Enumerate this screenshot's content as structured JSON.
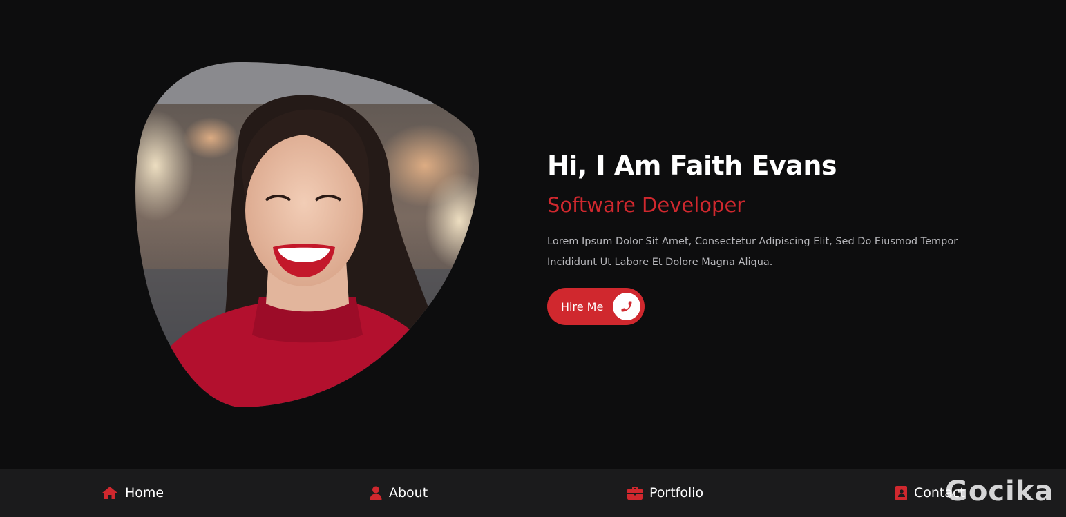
{
  "hero": {
    "title": "Hi, I Am Faith Evans",
    "role": "Software Developer",
    "description": "Lorem Ipsum Dolor Sit Amet, Consectetur Adipiscing Elit, Sed Do Eiusmod Tempor Incididunt Ut Labore Et Dolore Magna Aliqua.",
    "hire_button": {
      "label": "Hire Me",
      "icon": "phone-icon"
    },
    "photo_alt": "profile-photo"
  },
  "nav": {
    "items": [
      {
        "label": "Home",
        "icon": "home-icon"
      },
      {
        "label": "About",
        "icon": "user-icon"
      },
      {
        "label": "Portfolio",
        "icon": "briefcase-icon"
      },
      {
        "label": "Contact",
        "icon": "address-book-icon"
      }
    ]
  },
  "watermark": "Gocika",
  "colors": {
    "accent": "#d0282e",
    "background": "#0d0d0e",
    "nav_background": "#1b1b1c",
    "text": "#ffffff",
    "muted_text": "#b7b7bb"
  }
}
